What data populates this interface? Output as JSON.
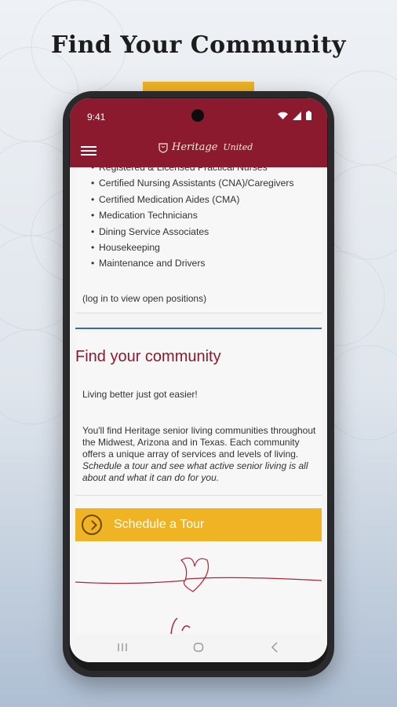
{
  "promo": {
    "headline": "Find Your Community",
    "accent_color": "#f0b323"
  },
  "statusbar": {
    "time": "9:41",
    "icons": [
      "wifi-icon",
      "signal-icon",
      "battery-icon"
    ]
  },
  "appbar": {
    "brand": "Heritage",
    "brand_sub": "United",
    "background": "#8b1a2f",
    "menu_icon": "hamburger-icon"
  },
  "jobs": {
    "items": [
      "Registered & Licensed Practical Nurses",
      "Certified Nursing Assistants (CNA)/Caregivers",
      "Certified Medication Aides (CMA)",
      "Medication Technicians",
      "Dining Service Associates",
      "Housekeeping",
      "Maintenance and Drivers"
    ],
    "login_note": "(log in to view open positions)"
  },
  "community": {
    "title": "Find your community",
    "tagline": "Living better just got easier!",
    "description": "You'll find Heritage senior living communities throughout the Midwest, Arizona and in Texas. Each community offers a unique array of services and levels of living. ",
    "description_italic": "Schedule a tour and see what active senior living is all about and what it can do for you."
  },
  "cta": {
    "label": "Schedule a Tour",
    "icon": "chevron-right-circle-icon"
  },
  "navbar": {
    "icons": [
      "recents-icon",
      "home-icon",
      "back-icon"
    ]
  }
}
